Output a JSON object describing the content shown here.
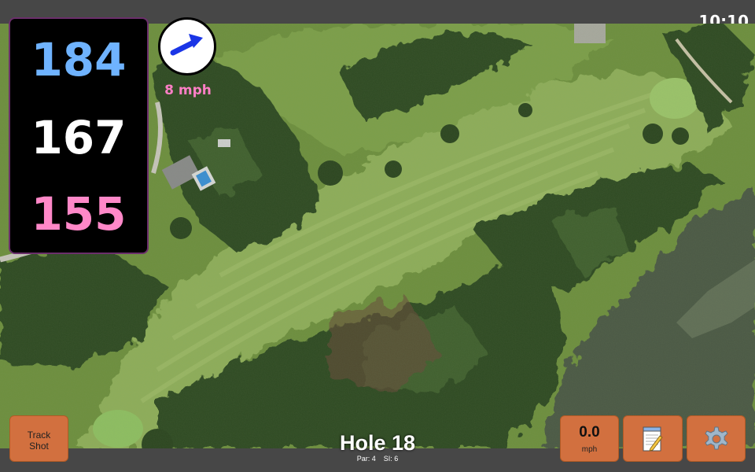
{
  "status_bar": {
    "time": "10:10"
  },
  "distances": {
    "back": "184",
    "middle": "167",
    "front": "155"
  },
  "colors": {
    "back": "#6fb3ff",
    "middle": "#ffffff",
    "front": "#ff88c8",
    "wind_speed": "#ff7fc6",
    "button": "#d2703f",
    "wind_arrow": "#1a35e6"
  },
  "wind": {
    "speed_label": "8 mph",
    "arrow_icon": "wind-direction-arrow-icon"
  },
  "hole": {
    "title": "Hole 18",
    "par_label": "Par: 4",
    "si_label": "SI: 6"
  },
  "buttons": {
    "track_shot_line1": "Track",
    "track_shot_line2": "Shot",
    "speed_value": "0.0",
    "speed_unit": "mph",
    "notes_icon": "notepad-icon",
    "settings_icon": "gear-icon"
  }
}
